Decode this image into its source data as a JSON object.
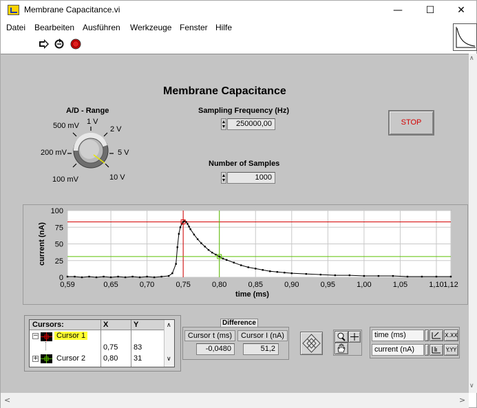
{
  "window": {
    "title": "Membrane Capacitance.vi",
    "minimize_glyph": "—",
    "maximize_glyph": "☐",
    "close_glyph": "✕"
  },
  "menu": [
    "Datei",
    "Bearbeiten",
    "Ausführen",
    "Werkzeuge",
    "Fenster",
    "Hilfe"
  ],
  "panel": {
    "title": "Membrane Capacitance",
    "range": {
      "label": "A/D - Range",
      "ticks": [
        "500 mV",
        "1 V",
        "2 V",
        "200 mV",
        "5 V",
        "100 mV",
        "10 V"
      ],
      "selected": "5 V"
    },
    "sampling": {
      "label": "Sampling Frequency (Hz)",
      "value": "250000,00"
    },
    "samples": {
      "label": "Number of Samples",
      "value": "1000"
    },
    "stop_label": "STOP"
  },
  "chart_data": {
    "type": "line",
    "xlabel": "time (ms)",
    "ylabel": "current (nA)",
    "xlim": [
      0.59,
      1.12
    ],
    "ylim": [
      0,
      100
    ],
    "xticks": [
      "0,59",
      "0,65",
      "0,70",
      "0,75",
      "0,80",
      "0,85",
      "0,90",
      "0,95",
      "1,00",
      "1,05",
      "1,10",
      "1,12"
    ],
    "xtick_values": [
      0.59,
      0.65,
      0.7,
      0.75,
      0.8,
      0.85,
      0.9,
      0.95,
      1.0,
      1.05,
      1.1,
      1.12
    ],
    "yticks": [
      "0",
      "25",
      "50",
      "75",
      "100"
    ],
    "ytick_values": [
      0,
      25,
      50,
      75,
      100
    ],
    "grid": true,
    "series": [
      {
        "x": [
          0.59,
          0.6,
          0.61,
          0.62,
          0.63,
          0.64,
          0.65,
          0.66,
          0.67,
          0.68,
          0.69,
          0.7,
          0.71,
          0.72,
          0.73,
          0.735,
          0.74,
          0.742,
          0.744,
          0.746,
          0.748,
          0.75,
          0.752,
          0.754,
          0.756,
          0.758,
          0.76,
          0.765,
          0.77,
          0.775,
          0.78,
          0.785,
          0.79,
          0.795,
          0.8,
          0.805,
          0.81,
          0.82,
          0.83,
          0.84,
          0.85,
          0.86,
          0.87,
          0.88,
          0.89,
          0.9,
          0.92,
          0.94,
          0.96,
          0.98,
          1.0,
          1.02,
          1.04,
          1.06,
          1.08,
          1.1,
          1.12
        ],
        "y": [
          1,
          1,
          0,
          1,
          0,
          1,
          0,
          1,
          0,
          1,
          0,
          1,
          0,
          1,
          2,
          6,
          20,
          45,
          65,
          75,
          80,
          83,
          84,
          83,
          80,
          76,
          72,
          64,
          57,
          51,
          46,
          41,
          37,
          34,
          31,
          28,
          26,
          22,
          18,
          15,
          13,
          11,
          9,
          8,
          7,
          6,
          5,
          4,
          3,
          3,
          2,
          2,
          2,
          1,
          1,
          1,
          1
        ]
      }
    ],
    "cursor_lines": [
      {
        "x": 0.75,
        "y": 83,
        "color": "#d40000"
      },
      {
        "x": 0.8,
        "y": 31,
        "color": "#5cc000"
      }
    ]
  },
  "cursors_table": {
    "headers": [
      "Cursors:",
      "X",
      "Y"
    ],
    "rows": [
      {
        "name": "Cursor 1",
        "x": "",
        "y": ""
      },
      {
        "name": "",
        "x": "0,75",
        "y": "83"
      },
      {
        "name": "Cursor 2",
        "x": "0,80",
        "y": "31"
      }
    ]
  },
  "difference": {
    "label": "Difference",
    "t_label": "Cursor t (ms)",
    "i_label": "Cursor I (nA)",
    "t_value": "-0,0480",
    "i_value": "51,2"
  },
  "scale_legend": {
    "x_name": "time (ms)",
    "y_name": "current (nA)",
    "x_format": "X.XX",
    "y_format": "Y.YY"
  }
}
